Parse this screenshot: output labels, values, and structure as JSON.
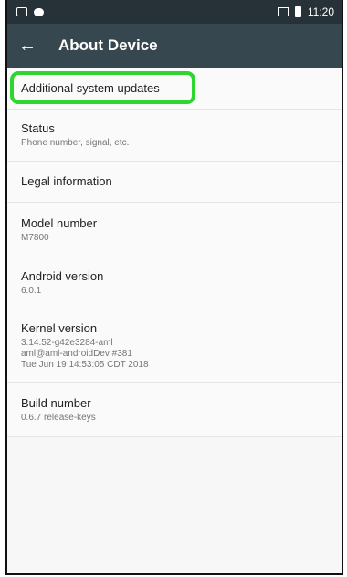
{
  "status_bar": {
    "time": "11:20"
  },
  "app_bar": {
    "back_icon": "←",
    "title": "About Device"
  },
  "items": [
    {
      "title": "Additional system updates",
      "subtitle": ""
    },
    {
      "title": "Status",
      "subtitle": "Phone number, signal, etc."
    },
    {
      "title": "Legal information",
      "subtitle": ""
    },
    {
      "title": "Model number",
      "subtitle": "M7800"
    },
    {
      "title": "Android version",
      "subtitle": "6.0.1"
    },
    {
      "title": "Kernel version",
      "subtitle_lines": [
        "3.14.52-g42e3284-aml",
        "aml@aml-androidDev #381",
        "Tue Jun 19 14:53:05 CDT 2018"
      ]
    },
    {
      "title": "Build number",
      "subtitle": "0.6.7 release-keys"
    }
  ],
  "colors": {
    "status_bar_bg": "#263238",
    "app_bar_bg": "#37474f",
    "highlight": "#2fd62f"
  }
}
